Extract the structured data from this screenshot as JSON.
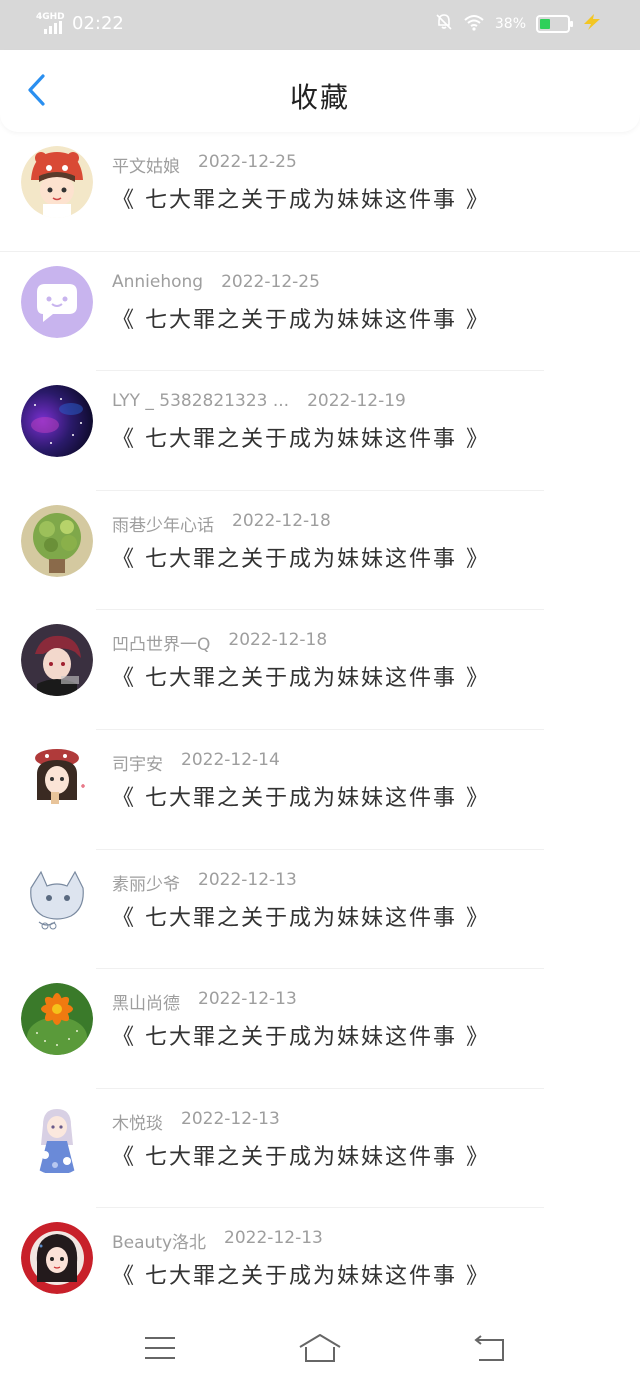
{
  "status_bar": {
    "network": "4GHD",
    "time": "02:22",
    "battery_percent": "38%",
    "battery_level": 0.38,
    "icons": [
      "signal-icon",
      "silent-bell-icon",
      "wifi-icon",
      "battery-icon",
      "charging-icon"
    ]
  },
  "header": {
    "title": "收藏",
    "back_icon": "chevron-left-icon",
    "accent_color": "#2a8ff0"
  },
  "favorites": [
    {
      "user": "平文姑娘",
      "date": "2022-12-25",
      "title": "《 七大罪之关于成为妹妹这件事 》",
      "avatar": "avatar-girl-red-hat"
    },
    {
      "user": "Anniehong",
      "date": "2022-12-25",
      "title": "《 七大罪之关于成为妹妹这件事 》",
      "avatar": "avatar-chat-bubble"
    },
    {
      "user": "LYY _ 5382821323 ...",
      "date": "2022-12-19",
      "title": "《 七大罪之关于成为妹妹这件事 》",
      "avatar": "avatar-galaxy"
    },
    {
      "user": "雨巷少年心话",
      "date": "2022-12-18",
      "title": "《 七大罪之关于成为妹妹这件事 》",
      "avatar": "avatar-plant"
    },
    {
      "user": "凹凸世界一Q",
      "date": "2022-12-18",
      "title": "《 七大罪之关于成为妹妹这件事 》",
      "avatar": "avatar-anime-boy"
    },
    {
      "user": "司宇安",
      "date": "2022-12-14",
      "title": "《 七大罪之关于成为妹妹这件事 》",
      "avatar": "avatar-girl-beret"
    },
    {
      "user": "素丽少爷",
      "date": "2022-12-13",
      "title": "《 七大罪之关于成为妹妹这件事 》",
      "avatar": "avatar-sketch-cat"
    },
    {
      "user": "黑山尚德",
      "date": "2022-12-13",
      "title": "《 七大罪之关于成为妹妹这件事 》",
      "avatar": "avatar-cactus-flower"
    },
    {
      "user": "木悦琰",
      "date": "2022-12-13",
      "title": "《 七大罪之关于成为妹妹这件事 》",
      "avatar": "avatar-girl-blue-dress"
    },
    {
      "user": "Beauty洛北",
      "date": "2022-12-13",
      "title": "《 七大罪之关于成为妹妹这件事 》",
      "avatar": "avatar-girl-red-circle"
    }
  ],
  "nav_bar": {
    "buttons": [
      "menu-icon",
      "home-icon",
      "back-icon"
    ]
  }
}
